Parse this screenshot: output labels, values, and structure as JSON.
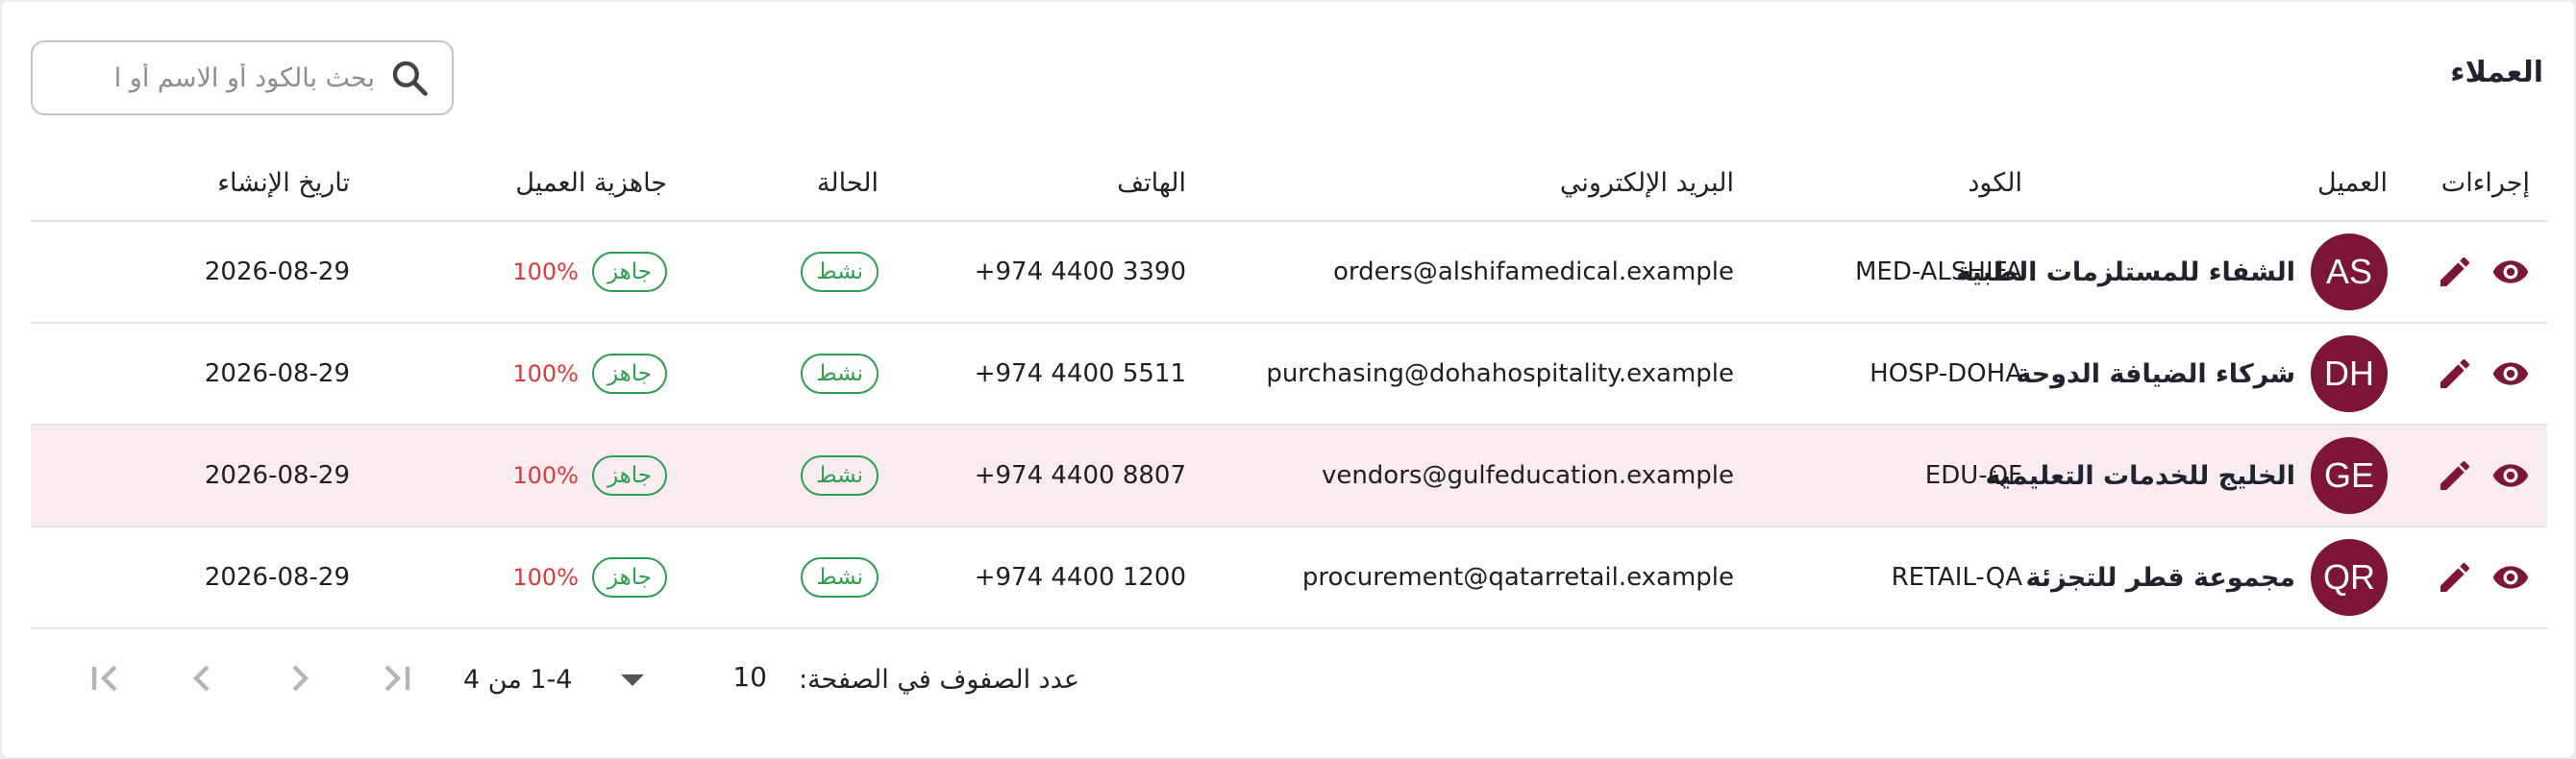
{
  "header": {
    "title": "العملاء",
    "search_placeholder": "بحث بالكود أو الاسم أو ا"
  },
  "columns": {
    "actions": "إجراءات",
    "client": "العميل",
    "code": "الكود",
    "email": "البريد الإلكتروني",
    "phone": "الهاتف",
    "status": "الحالة",
    "readiness": "جاهزية العميل",
    "created": "تاريخ الإنشاء"
  },
  "rows": [
    {
      "initials": "AS",
      "name": "الشفاء للمستلزمات الطبية",
      "code": "MED-ALSHIFA",
      "email": "orders@alshifamedical.example",
      "phone": "+974 4400 3390",
      "status": "نشط",
      "ready": "جاهز",
      "percent": "100%",
      "created": "2026-08-29"
    },
    {
      "initials": "DH",
      "name": "شركاء الضيافة الدوحة",
      "code": "HOSP-DOHA",
      "email": "purchasing@dohahospitality.example",
      "phone": "+974 4400 5511",
      "status": "نشط",
      "ready": "جاهز",
      "percent": "100%",
      "created": "2026-08-29"
    },
    {
      "initials": "GE",
      "name": "الخليج للخدمات التعليمية",
      "code": "EDU-QF",
      "email": "vendors@gulfeducation.example",
      "phone": "+974 4400 8807",
      "status": "نشط",
      "ready": "جاهز",
      "percent": "100%",
      "created": "2026-08-29"
    },
    {
      "initials": "QR",
      "name": "مجموعة قطر للتجزئة",
      "code": "RETAIL-QA",
      "email": "procurement@qatarretail.example",
      "phone": "+974 4400 1200",
      "status": "نشط",
      "ready": "جاهز",
      "percent": "100%",
      "created": "2026-08-29"
    }
  ],
  "pagination": {
    "rows_per_page_label": "عدد الصفوف في الصفحة:",
    "rows_per_page_value": "10",
    "range": "1-4 من 4"
  },
  "colors": {
    "avatar": "#7c1538",
    "status_chip": "#2e9e4f",
    "percent": "#d63b3b",
    "row_highlight": "#f8ecf1"
  },
  "icons": {
    "search": "search-icon",
    "view": "eye-icon",
    "edit": "pencil-icon",
    "dropdown": "caret-down-icon",
    "first": "first-page-icon",
    "prev": "chevron-left-icon",
    "next": "chevron-right-icon",
    "last": "last-page-icon"
  }
}
